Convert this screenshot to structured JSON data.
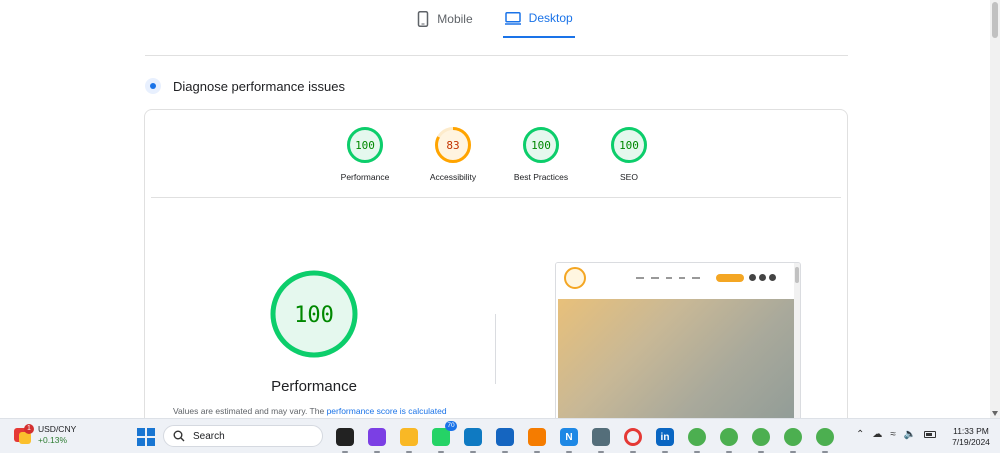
{
  "tabs": [
    {
      "label": "Mobile",
      "icon": "phone-icon",
      "active": false
    },
    {
      "label": "Desktop",
      "icon": "monitor-icon",
      "active": true
    }
  ],
  "diagnose": {
    "title": "Diagnose performance issues"
  },
  "scores": [
    {
      "label": "Performance",
      "value": "100",
      "fraction": 1.0,
      "color": "#0cce6b",
      "text_color": "#008800"
    },
    {
      "label": "Accessibility",
      "value": "83",
      "fraction": 0.83,
      "color": "#ffa400",
      "text_color": "#c33300"
    },
    {
      "label": "Best Practices",
      "value": "100",
      "fraction": 1.0,
      "color": "#0cce6b",
      "text_color": "#008800"
    },
    {
      "label": "SEO",
      "value": "100",
      "fraction": 1.0,
      "color": "#0cce6b",
      "text_color": "#008800"
    }
  ],
  "main_score": {
    "label": "Performance",
    "value": "100",
    "fraction": 1.0,
    "color": "#0cce6b",
    "text_color": "#008800"
  },
  "disclaimer": {
    "prefix": "Values are estimated and may vary. The ",
    "link": "performance score is calculated"
  },
  "taskbar": {
    "ticker": {
      "symbol": "USD/CNY",
      "change": "+0.13%",
      "badge": "1"
    },
    "search_placeholder": "Search",
    "apps": [
      {
        "name": "file-manager-app",
        "icon": "terminal-icon",
        "color": "#222222",
        "glyph": ""
      },
      {
        "name": "chat-app",
        "icon": "chat-icon",
        "color": "#7b3fe4",
        "glyph": ""
      },
      {
        "name": "file-explorer-app",
        "icon": "folder-icon",
        "color": "#f9b825",
        "glyph": ""
      },
      {
        "name": "whatsapp-app",
        "icon": "whatsapp-icon",
        "color": "#25d366",
        "glyph": "",
        "badge": "70"
      },
      {
        "name": "edge-app",
        "icon": "edge-icon",
        "color": "#0f7ac2",
        "glyph": ""
      },
      {
        "name": "store-app",
        "icon": "store-icon",
        "color": "#1565c0",
        "glyph": ""
      },
      {
        "name": "vlc-app",
        "icon": "vlc-icon",
        "color": "#f57c00",
        "glyph": ""
      },
      {
        "name": "notion-app",
        "icon": "n-icon",
        "color": "#1e88e5",
        "glyph": "N"
      },
      {
        "name": "window-app",
        "icon": "window-icon",
        "color": "#546e7a",
        "glyph": ""
      },
      {
        "name": "opera-app",
        "icon": "opera-icon",
        "color": "#e53935",
        "glyph": ""
      },
      {
        "name": "linkedin-app",
        "icon": "linkedin-icon",
        "color": "#0a66c2",
        "glyph": "in"
      },
      {
        "name": "chrome-app-1",
        "icon": "chrome-icon",
        "color": "#4caf50",
        "glyph": ""
      },
      {
        "name": "chrome-app-2",
        "icon": "chrome-icon",
        "color": "#4caf50",
        "glyph": ""
      },
      {
        "name": "chrome-app-3",
        "icon": "chrome-icon",
        "color": "#4caf50",
        "glyph": ""
      },
      {
        "name": "chrome-app-4",
        "icon": "chrome-icon",
        "color": "#4caf50",
        "glyph": ""
      },
      {
        "name": "chrome-app-5",
        "icon": "chrome-icon",
        "color": "#4caf50",
        "glyph": ""
      }
    ],
    "clock": {
      "time": "11:33 PM",
      "date": "7/19/2024"
    }
  }
}
